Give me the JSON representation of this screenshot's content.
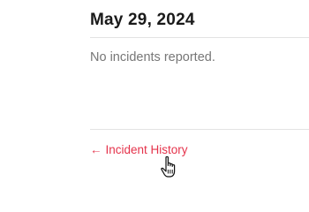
{
  "day": {
    "date": "May 29, 2024",
    "message": "No incidents reported."
  },
  "history_link": {
    "arrow": "←",
    "label": "Incident History"
  },
  "colors": {
    "link": "#e5334b",
    "heading": "#1a1a1a",
    "message": "#777777",
    "divider": "#e3e3e3"
  },
  "cursor": {
    "icon": "hand-pointer-icon"
  }
}
